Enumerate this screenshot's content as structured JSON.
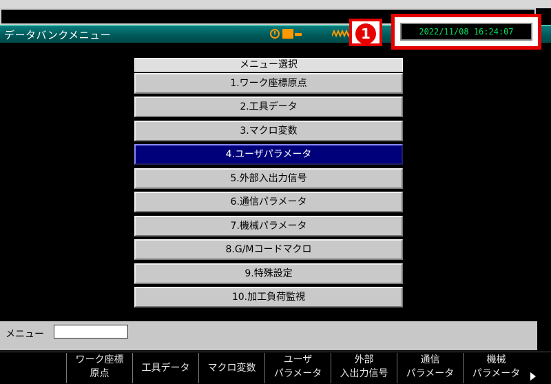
{
  "screen_title": "データバンクメニュー",
  "badge_number": "1",
  "datetime": "2022/11/08 16:24:07",
  "menu": {
    "header": "メニュー選択",
    "items": [
      "1.ワーク座標原点",
      "2.工具データ",
      "3.マクロ変数",
      "4.ユーザパラメータ",
      "5.外部入出力信号",
      "6.通信パラメータ",
      "7.機械パラメータ",
      "8.G/Mコードマクロ",
      "9.特殊設定",
      "10.加工負荷監視"
    ],
    "selected_index": 3
  },
  "input": {
    "label": "メニュー",
    "value": ""
  },
  "fkeys": [
    [
      "ワーク座標",
      "原点"
    ],
    [
      "工具データ"
    ],
    [
      "マクロ変数"
    ],
    [
      "ユーザ",
      "パラメータ"
    ],
    [
      "外部",
      "入出力信号"
    ],
    [
      "通信",
      "パラメータ"
    ],
    [
      "機械",
      "パラメータ"
    ]
  ],
  "indicators": [
    "clock-icon",
    "module-icon",
    "wave-icon"
  ],
  "colors": {
    "title_bar": "#005a5a",
    "selected": "#00007a",
    "datetime": "#00e060",
    "highlight": "#e60000"
  }
}
